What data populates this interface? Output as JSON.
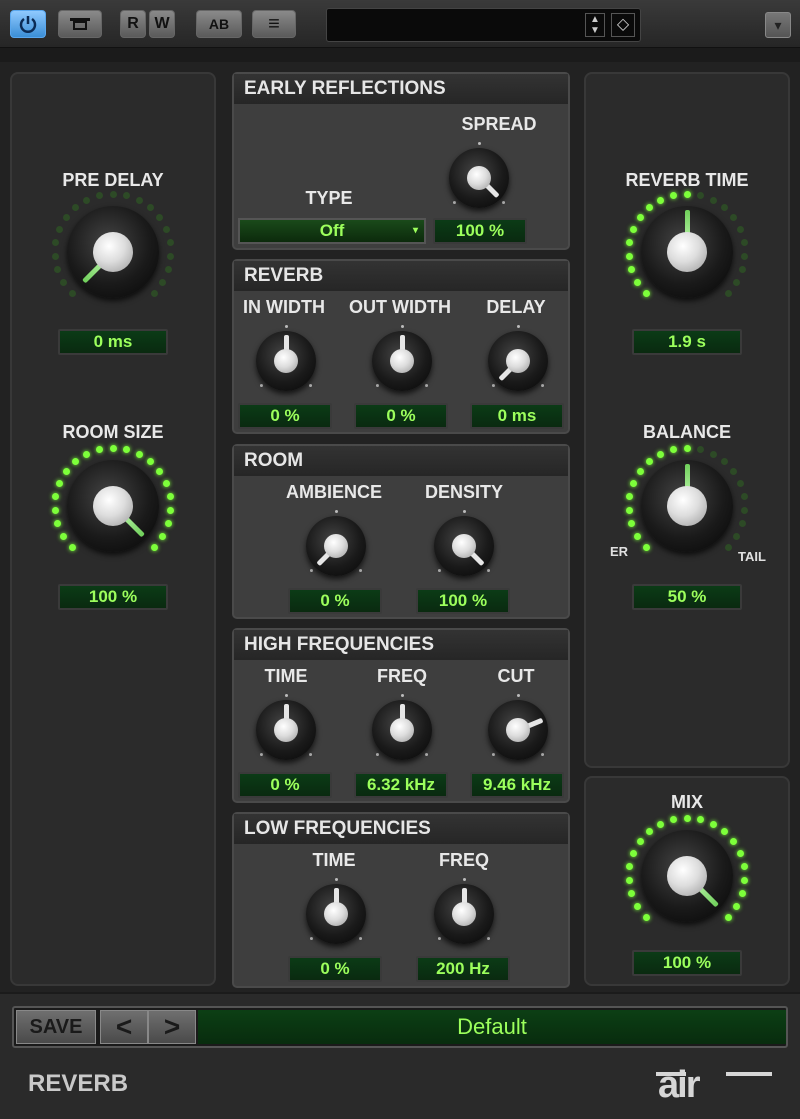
{
  "toolbar": {
    "rw_r": "R",
    "rw_w": "W",
    "ab": "AB",
    "list": "≡",
    "preset_name": "",
    "menu": "▾"
  },
  "left": {
    "pre_delay": {
      "label": "PRE DELAY",
      "value": "0 ms",
      "level": 0.0
    },
    "room_size": {
      "label": "ROOM SIZE",
      "value": "100 %",
      "level": 1.0
    }
  },
  "sections": {
    "early": {
      "title": "EARLY REFLECTIONS",
      "type_label": "TYPE",
      "type_value": "Off",
      "spread_label": "SPREAD",
      "spread_value": "100 %"
    },
    "reverb": {
      "title": "REVERB",
      "in_width_label": "IN WIDTH",
      "in_width_value": "0 %",
      "out_width_label": "OUT WIDTH",
      "out_width_value": "0 %",
      "delay_label": "DELAY",
      "delay_value": "0 ms"
    },
    "room": {
      "title": "ROOM",
      "ambience_label": "AMBIENCE",
      "ambience_value": "0 %",
      "density_label": "DENSITY",
      "density_value": "100 %"
    },
    "high": {
      "title": "HIGH FREQUENCIES",
      "time_label": "TIME",
      "time_value": "0 %",
      "freq_label": "FREQ",
      "freq_value": "6.32 kHz",
      "cut_label": "CUT",
      "cut_value": "9.46 kHz"
    },
    "low": {
      "title": "LOW FREQUENCIES",
      "time_label": "TIME",
      "time_value": "0 %",
      "freq_label": "FREQ",
      "freq_value": "200 Hz"
    }
  },
  "right": {
    "reverb_time": {
      "label": "REVERB TIME",
      "value": "1.9 s",
      "level": 0.5
    },
    "balance": {
      "label": "BALANCE",
      "value": "50 %",
      "left_tag": "ER",
      "right_tag": "TAIL",
      "level": 0.5
    },
    "mix": {
      "label": "MIX",
      "value": "100 %",
      "level": 1.0
    }
  },
  "presetbar": {
    "save": "SAVE",
    "prev": "<",
    "next": ">",
    "preset": "Default"
  },
  "footer": {
    "plugin_name": "REVERB",
    "brand": "AIR"
  },
  "colors": {
    "led_on": "#7dff3a",
    "led_off": "#2d4a26",
    "value_text": "#9cff5c"
  }
}
